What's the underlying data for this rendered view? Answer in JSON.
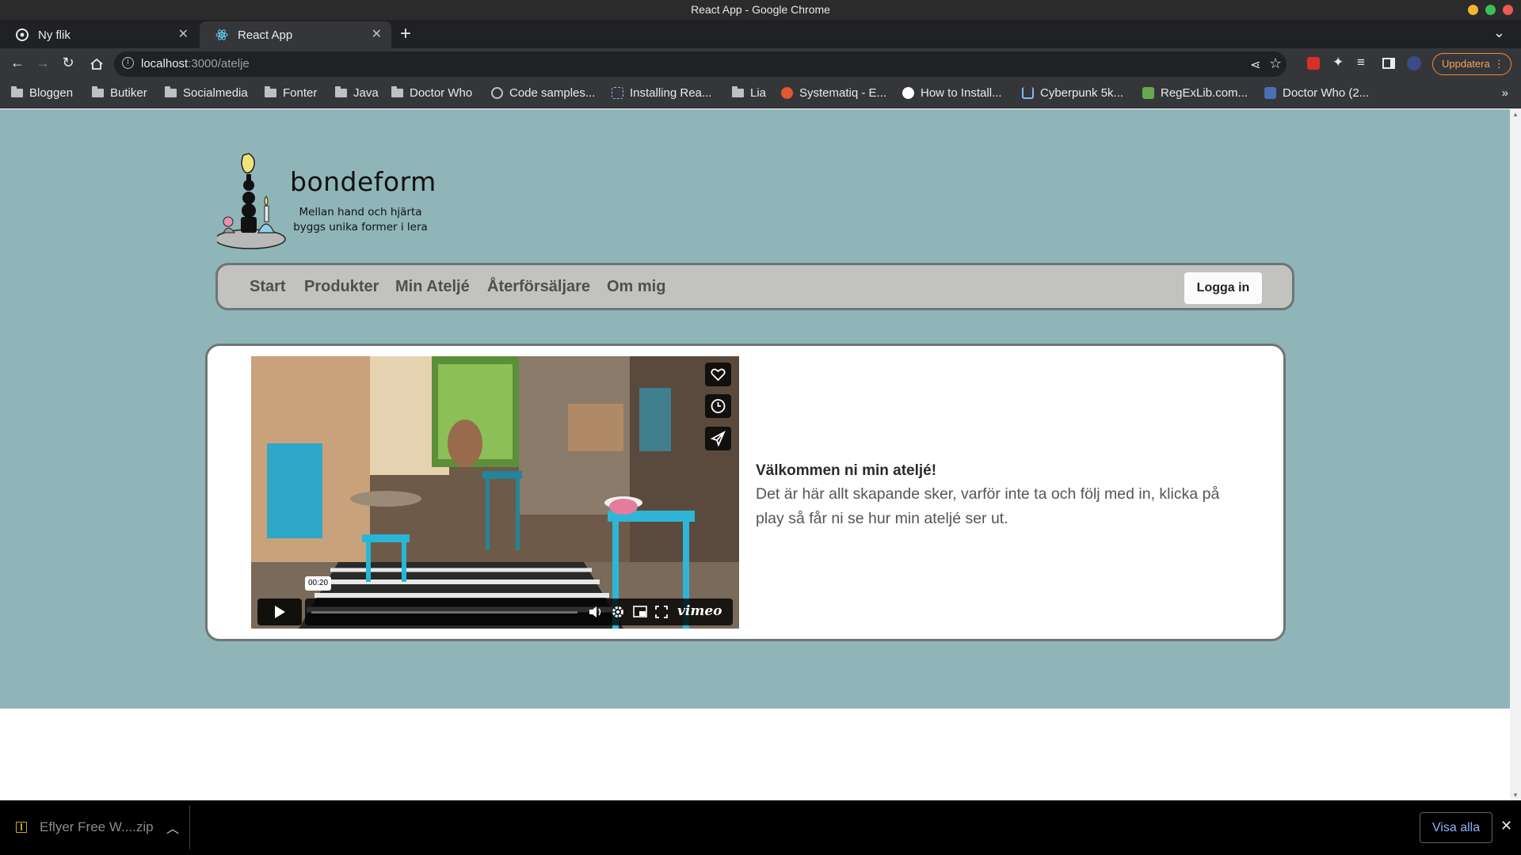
{
  "window": {
    "title": "React App - Google Chrome"
  },
  "tabs": [
    {
      "label": "Ny flik",
      "active": false
    },
    {
      "label": "React App",
      "active": true
    }
  ],
  "toolbar": {
    "url_host": "localhost",
    "url_path": ":3000/atelje",
    "update_label": "Uppdatera"
  },
  "bookmarks": [
    {
      "label": "Bloggen",
      "icon": "folder-icon"
    },
    {
      "label": "Butiker",
      "icon": "folder-icon"
    },
    {
      "label": "Socialmedia",
      "icon": "folder-icon"
    },
    {
      "label": "Fonter",
      "icon": "folder-icon"
    },
    {
      "label": "Java",
      "icon": "folder-icon"
    },
    {
      "label": "Doctor Who",
      "icon": "folder-icon"
    },
    {
      "label": "Code samples...",
      "icon": "globe-icon"
    },
    {
      "label": "Installing Rea...",
      "icon": "site-icon"
    },
    {
      "label": "Lia",
      "icon": "folder-icon"
    },
    {
      "label": "Systematiq - E...",
      "icon": "site-icon"
    },
    {
      "label": "How to Install...",
      "icon": "site-icon"
    },
    {
      "label": "Cyberpunk 5k...",
      "icon": "site-icon"
    },
    {
      "label": "RegExLib.com...",
      "icon": "site-icon"
    },
    {
      "label": "Doctor Who (2...",
      "icon": "site-icon"
    }
  ],
  "site": {
    "logo_name": "bondeform",
    "logo_tagline_1": "Mellan hand och hjärta",
    "logo_tagline_2": "byggs unika former i lera",
    "nav": [
      "Start",
      "Produkter",
      "Min Ateljé",
      "Återförsäljare",
      "Om mig"
    ],
    "login_label": "Logga in"
  },
  "content": {
    "heading": "Välkommen ni min ateljé!",
    "body": "Det är här allt skapande sker, varför inte ta och följ med in, klicka på play så får ni se hur min ateljé ser ut.",
    "video": {
      "time": "00:20",
      "brand": "vimeo",
      "progress": 0
    }
  },
  "download_bar": {
    "file": "Eflyer Free W....zip",
    "show_all_label": "Visa alla"
  },
  "colors": {
    "page_background": "#8fb5b9",
    "nav_background": "#c2c2bf",
    "border": "#6e7675"
  }
}
